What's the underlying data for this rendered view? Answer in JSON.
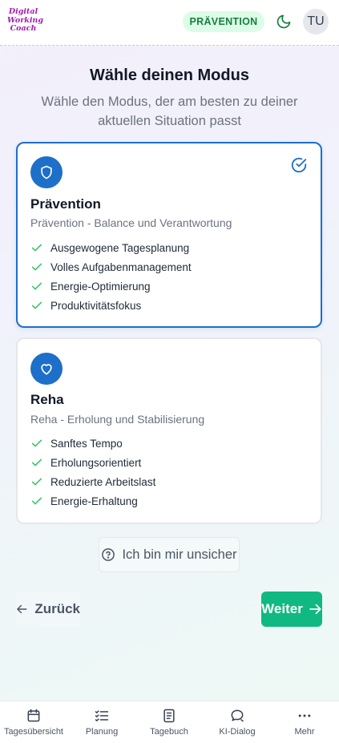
{
  "header": {
    "logo_lines": [
      "Digital",
      "Working",
      "Coach"
    ],
    "mode_badge": "PRÄVENTION",
    "avatar_initials": "TU",
    "theme_icon": "moon-icon"
  },
  "page": {
    "title": "Wähle deinen Modus",
    "subtitle": "Wähle den Modus, der am besten zu deiner aktuellen Situation passt"
  },
  "modes": [
    {
      "name": "Prävention",
      "description": "Prävention - Balance und Verantwortung",
      "icon": "shield-icon",
      "selected": true,
      "features": [
        "Ausgewogene Tagesplanung",
        "Volles Aufgabenmanagement",
        "Energie-Optimierung",
        "Produktivitätsfokus"
      ]
    },
    {
      "name": "Reha",
      "description": "Reha - Erholung und Stabilisierung",
      "icon": "heart-icon",
      "selected": false,
      "features": [
        "Sanftes Tempo",
        "Erholungsorientiert",
        "Reduzierte Arbeitslast",
        "Energie-Erhaltung"
      ]
    }
  ],
  "actions": {
    "unsure_label": "Ich bin mir unsicher",
    "back_label": "Zurück",
    "next_label": "Weiter"
  },
  "bottom_nav": [
    {
      "label": "Tagesübersicht",
      "icon": "calendar-icon"
    },
    {
      "label": "Planung",
      "icon": "list-check-icon"
    },
    {
      "label": "Tagebuch",
      "icon": "book-icon"
    },
    {
      "label": "KI-Dialog",
      "icon": "chat-icon"
    },
    {
      "label": "Mehr",
      "icon": "more-icon"
    }
  ],
  "colors": {
    "accent_blue": "#1d6fc9",
    "success_green": "#10b981",
    "badge_bg": "#dcfce7",
    "badge_text": "#15803d",
    "logo": "#a21caf"
  }
}
